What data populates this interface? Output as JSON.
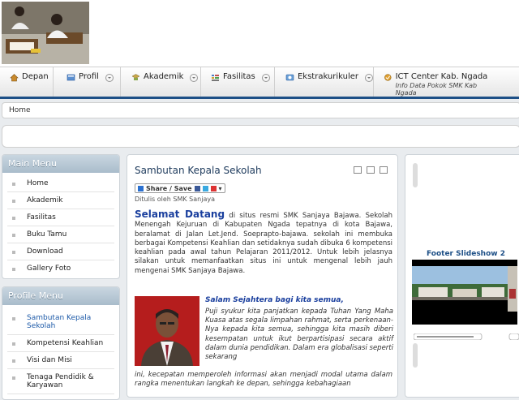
{
  "nav": {
    "items": [
      {
        "label": "Depan",
        "icon": "home-icon",
        "dropdown": false
      },
      {
        "label": "Profil",
        "icon": "profile-icon",
        "dropdown": true
      },
      {
        "label": "Akademik",
        "icon": "academic-icon",
        "dropdown": true
      },
      {
        "label": "Fasilitas",
        "icon": "facility-icon",
        "dropdown": true
      },
      {
        "label": "Ekstrakurikuler",
        "icon": "extracurricular-icon",
        "dropdown": true
      },
      {
        "label": "ICT Center Kab. Ngada",
        "sub": "Info Data Pokok SMK Kab Ngada",
        "icon": "ict-icon",
        "dropdown": false
      }
    ]
  },
  "breadcrumb": {
    "home": "Home"
  },
  "main_menu": {
    "title": "Main Menu",
    "items": [
      "Home",
      "Akademik",
      "Fasilitas",
      "Buku Tamu",
      "Download",
      "Gallery Foto"
    ]
  },
  "profile_menu": {
    "title": "Profile Menu",
    "items": [
      "Sambutan Kepala Sekolah",
      "Kompetensi Keahlian",
      "Visi dan Misi",
      "Tenaga Pendidik & Karyawan"
    ]
  },
  "article": {
    "title": "Sambutan Kepala Sekolah",
    "share": "Share / Save",
    "author": "Ditulis oleh SMK Sanjaya",
    "welcome_strong": "Selamat Datang",
    "welcome_text": " di situs resmi SMK Sanjaya Bajawa. Sekolah Menengah Kejuruan di Kabupaten Ngada tepatnya di kota Bajawa, beralamat di Jalan Let.Jend. Soeprapto-bajawa. sekolah ini membuka berbagai Kompetensi Keahlian dan setidaknya sudah dibuka 6 kompetensi keahlian pada awal tahun Pelajaran 2011/2012. Untuk lebih jelasnya silakan untuk memanfaatkan situs ini untuk mengenal lebih jauh mengenai SMK Sanjaya Bajawa.",
    "salam": "Salam Sejahtera bagi kita semua,",
    "para": "Puji syukur kita panjatkan kepada Tuhan Yang Maha Kuasa atas segala limpahan rahmat, serta perkenaan-Nya kepada kita semua, sehingga kita masih diberi kesempatan untuk ikut berpartisipasi secara aktif dalam dunia pendidikan. Dalam era globalisasi seperti sekarang",
    "para2": "ini, kecepatan memperoleh informasi akan menjadi modal utama dalam rangka menentukan langkah ke depan, sehingga kebahagiaan"
  },
  "sidebar_right": {
    "slideshow_title": "Footer Slideshow 2"
  },
  "colors": {
    "nav_border": "#1d4f86",
    "heading_blue": "#1a3f9e",
    "panel_head": "#a9bccb"
  }
}
